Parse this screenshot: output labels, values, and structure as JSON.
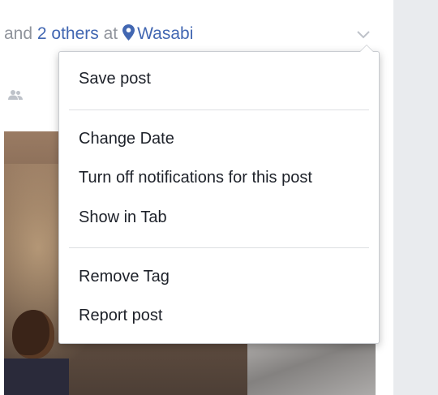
{
  "header": {
    "prefix": "and",
    "others_link": "2 others",
    "at_text": "at",
    "place_link": "Wasabi"
  },
  "icons": {
    "location": "map-pin-icon",
    "options": "chevron-down-icon",
    "audience": "friends-icon"
  },
  "colors": {
    "link": "#4267b2",
    "muted_text": "#90949c",
    "menu_text": "#1d2129"
  },
  "menu": {
    "groups": [
      [
        "Save post"
      ],
      [
        "Change Date",
        "Turn off notifications for this post",
        "Show in Tab"
      ],
      [
        "Remove Tag",
        "Report post"
      ]
    ]
  }
}
